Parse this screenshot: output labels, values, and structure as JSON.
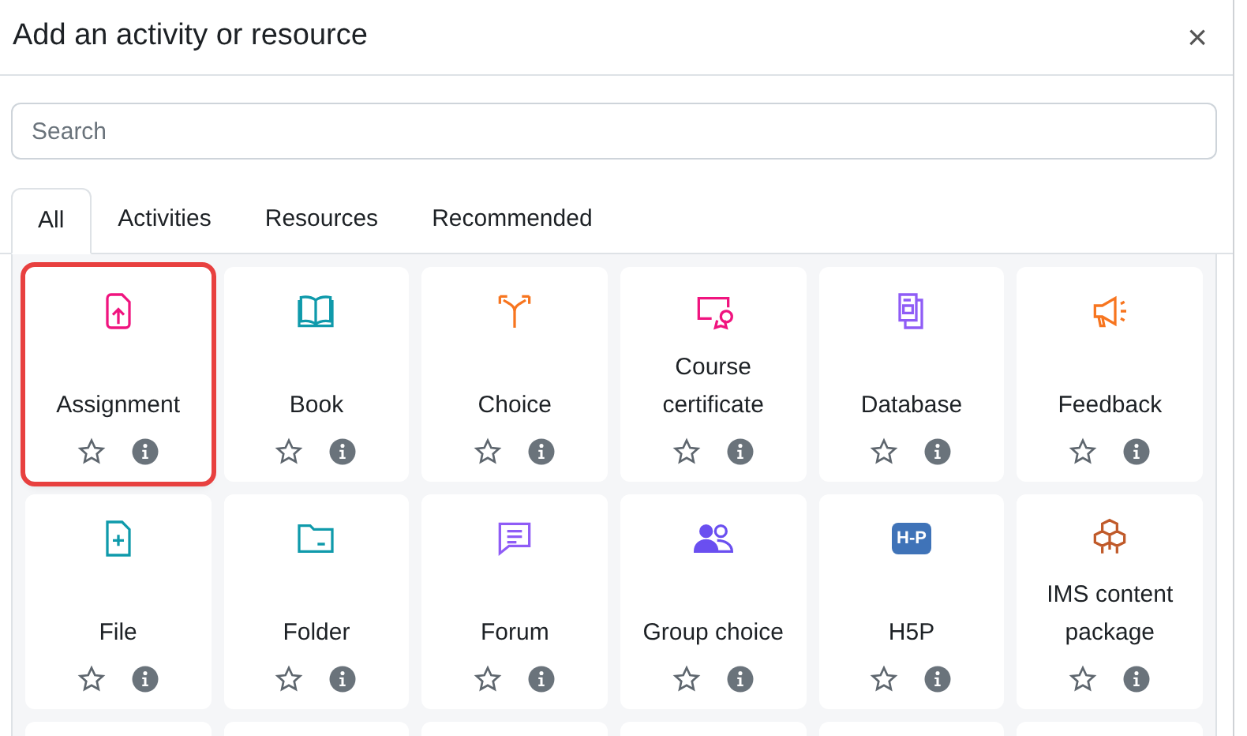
{
  "dialog": {
    "title": "Add an activity or resource",
    "close": "×"
  },
  "search": {
    "placeholder": "Search"
  },
  "tabs": [
    {
      "label": "All",
      "selected": true
    },
    {
      "label": "Activities",
      "selected": false
    },
    {
      "label": "Resources",
      "selected": false
    },
    {
      "label": "Recommended",
      "selected": false
    }
  ],
  "items": [
    {
      "label": "Assignment",
      "kind": "assignment",
      "color": "#f0147f",
      "highlighted": true,
      "starred": false
    },
    {
      "label": "Book",
      "kind": "book",
      "color": "#0f9aab",
      "highlighted": false,
      "starred": false
    },
    {
      "label": "Choice",
      "kind": "choice",
      "color": "#f7751f",
      "highlighted": false,
      "starred": false
    },
    {
      "label": "Course certificate",
      "kind": "certificate",
      "color": "#f0147f",
      "highlighted": false,
      "starred": false
    },
    {
      "label": "Database",
      "kind": "database",
      "color": "#8f5cf6",
      "highlighted": false,
      "starred": false
    },
    {
      "label": "Feedback",
      "kind": "feedback",
      "color": "#f7751f",
      "highlighted": false,
      "starred": false
    },
    {
      "label": "File",
      "kind": "file",
      "color": "#0f9aab",
      "highlighted": false,
      "starred": false
    },
    {
      "label": "Folder",
      "kind": "folder",
      "color": "#0f9aab",
      "highlighted": false,
      "starred": false
    },
    {
      "label": "Forum",
      "kind": "forum",
      "color": "#8f5cf6",
      "highlighted": false,
      "starred": false
    },
    {
      "label": "Group choice",
      "kind": "group",
      "color": "#6a4ff0",
      "highlighted": false,
      "starred": false
    },
    {
      "label": "H5P",
      "kind": "h5p",
      "color": "#3f73b8",
      "icon_text": "H-P",
      "highlighted": false,
      "starred": false
    },
    {
      "label": "IMS content package",
      "kind": "ims",
      "color": "#c05a2a",
      "highlighted": false,
      "starred": false
    }
  ]
}
